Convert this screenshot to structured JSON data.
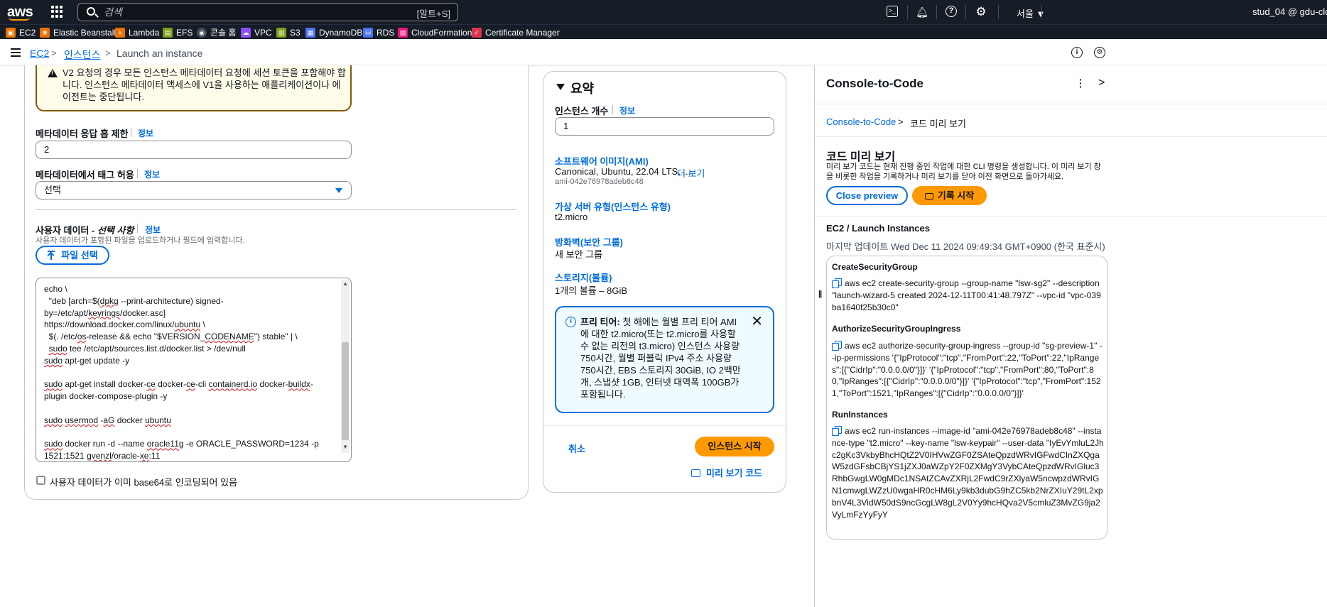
{
  "topnav": {
    "logo": "aws",
    "search_placeholder": "검색",
    "search_shortcut": "[알트+S]",
    "region": "서울 ▼",
    "account": "stud_04 @ gdu-clo",
    "icons": [
      "grid-icon",
      "cloudshell-icon",
      "bell-icon",
      "help-icon",
      "gear-icon"
    ]
  },
  "favorites": [
    {
      "label": "EC2",
      "color": "#ed7100"
    },
    {
      "label": "Elastic Beanstalk",
      "color": "#ed7100"
    },
    {
      "label": "Lambda",
      "color": "#ed7100"
    },
    {
      "label": "EFS",
      "color": "#7aa116"
    },
    {
      "label": "콘솔 홈",
      "color": "#414d5c"
    },
    {
      "label": "VPC",
      "color": "#8c4fff"
    },
    {
      "label": "S3",
      "color": "#7aa116"
    },
    {
      "label": "DynamoDB",
      "color": "#4d72f3"
    },
    {
      "label": "RDS",
      "color": "#4d72f3"
    },
    {
      "label": "CloudFormation",
      "color": "#e7157b"
    },
    {
      "label": "Certificate Manager",
      "color": "#dd344c"
    }
  ],
  "breadcrumb": {
    "ec2": "EC2",
    "instances": "인스턴스",
    "current": "Launch an instance"
  },
  "left": {
    "warning_text": "V2 요청의 경우 모든 인스턴스 메타데이터 요청에 세션 토큰을 포함해야 합니다. 인스턴스 메타데이터 액세스에 V1을 사용하는 애플리케이션이나 에이전트는 중단됩니다.",
    "hop_label": "메타데이터 응답 홉 제한",
    "hop_info": "정보",
    "hop_value": "2",
    "tag_label": "메타데이터에서 태그 허용",
    "tag_info": "정보",
    "tag_select": "선택",
    "userdata_label": "사용자 데이터 -",
    "userdata_optional": "선택 사항",
    "userdata_info": "정보",
    "userdata_desc": "사용자 데이터가 포함된 파일을 업로드하거나 필드에 입력합니다.",
    "file_button": "파일 선택",
    "base64_label": "사용자 데이터가 이미 base64로 인코딩되어 있음"
  },
  "summary": {
    "title": "요약",
    "count_label": "인스턴스 개수",
    "count_info": "정보",
    "count_value": "1",
    "ami_label": "소프트웨어 이미지(AMI)",
    "ami_value": "Canonical, Ubuntu, 22.04 LTS, ...",
    "ami_more": "더 보기",
    "ami_id": "ami-042e76978adeb8c48",
    "type_label": "가상 서버 유형(인스턴스 유형)",
    "type_value": "t2.micro",
    "fw_label": "방화벽(보안 그룹)",
    "fw_value": "새 보안 그룹",
    "storage_label": "스토리지(볼륨)",
    "storage_value": "1개의 볼륨 – 8GiB",
    "free_tier_bold": "프리 티어:",
    "free_tier_text": " 첫 해에는 월별 프리 티어 AMI에 대한 t2.micro(또는 t2.micro를 사용할 수 없는 리전의 t3.micro) 인스턴스 사용량 750시간, 월별 퍼블릭 IPv4 주소 사용량 750시간, EBS 스토리지 30GiB, IO 2백만 개, 스냅샷 1GB, 인터넷 대역폭 100GB가 포함됩니다.",
    "cancel": "취소",
    "launch": "인스턴스 시작",
    "preview_code": "미리 보기 코드"
  },
  "c2c": {
    "title": "Console-to-Code",
    "crumb_link": "Console-to-Code",
    "crumb_current": "코드 미리 보기",
    "heading": "코드 미리 보기",
    "desc": "미리 보기 코드는 현재 진행 중인 작업에 대한 CLI 명령을 생성합니다. 이 미리 보기 창을 비롯한 작업을 기록하거나 미리 보기를 닫아 이전 화면으로 돌아가세요.",
    "close_preview": "Close preview",
    "record": "기록 시작",
    "section": "EC2 / Launch Instances",
    "updated": "마지막 업데이트 Wed Dec 11 2024 09:49:34 GMT+0900 (한국 표준시)",
    "commands": [
      {
        "title": "CreateSecurityGroup",
        "code": "aws ec2 create-security-group --group-name \"lsw-sg2\" --description \"launch-wizard-5 created 2024-12-11T00:41:48.797Z\" --vpc-id \"vpc-039ba1640f25b30c0\""
      },
      {
        "title": "AuthorizeSecurityGroupIngress",
        "code": "aws ec2 authorize-security-group-ingress --group-id \"sg-preview-1\" --ip-permissions '{\"IpProtocol\":\"tcp\",\"FromPort\":22,\"ToPort\":22,\"IpRanges\":[{\"CidrIp\":\"0.0.0.0/0\"}]}' '{\"IpProtocol\":\"tcp\",\"FromPort\":80,\"ToPort\":80,\"IpRanges\":[{\"CidrIp\":\"0.0.0.0/0\"}]}' '{\"IpProtocol\":\"tcp\",\"FromPort\":1521,\"ToPort\":1521,\"IpRanges\":[{\"CidrIp\":\"0.0.0.0/0\"}]}'"
      },
      {
        "title": "RunInstances",
        "code": "aws ec2 run-instances --image-id \"ami-042e76978adeb8c48\" --instance-type \"t2.micro\" --key-name \"lsw-keypair\" --user-data \"IyEvYmluL2Jhc2gKc3VkbyBhcHQtZ2V0IHVwZGF0ZSAteQpzdWRvIGFwdCInZXQgaW5zdGFsbCBjYS1jZXJ0aWZpY2F0ZXMgY3VybCAteQpzdWRvIGluc3RhbGwgLW0gMDc1NSAtZCAvZXRjL2FwdC9rZXlyaW5ncwpzdWRvIGN1cmwgLWZzU0wgaHR0cHM6Ly9kb3dubG9hZC5kb2NrZXIuY29tL2xpbnV4L3VidW50dS9ncGcgLW8gL2V0Yy9hcHQva2V5cmluZ3MvZG9ja2VyLmFzYyFyY"
      }
    ]
  }
}
